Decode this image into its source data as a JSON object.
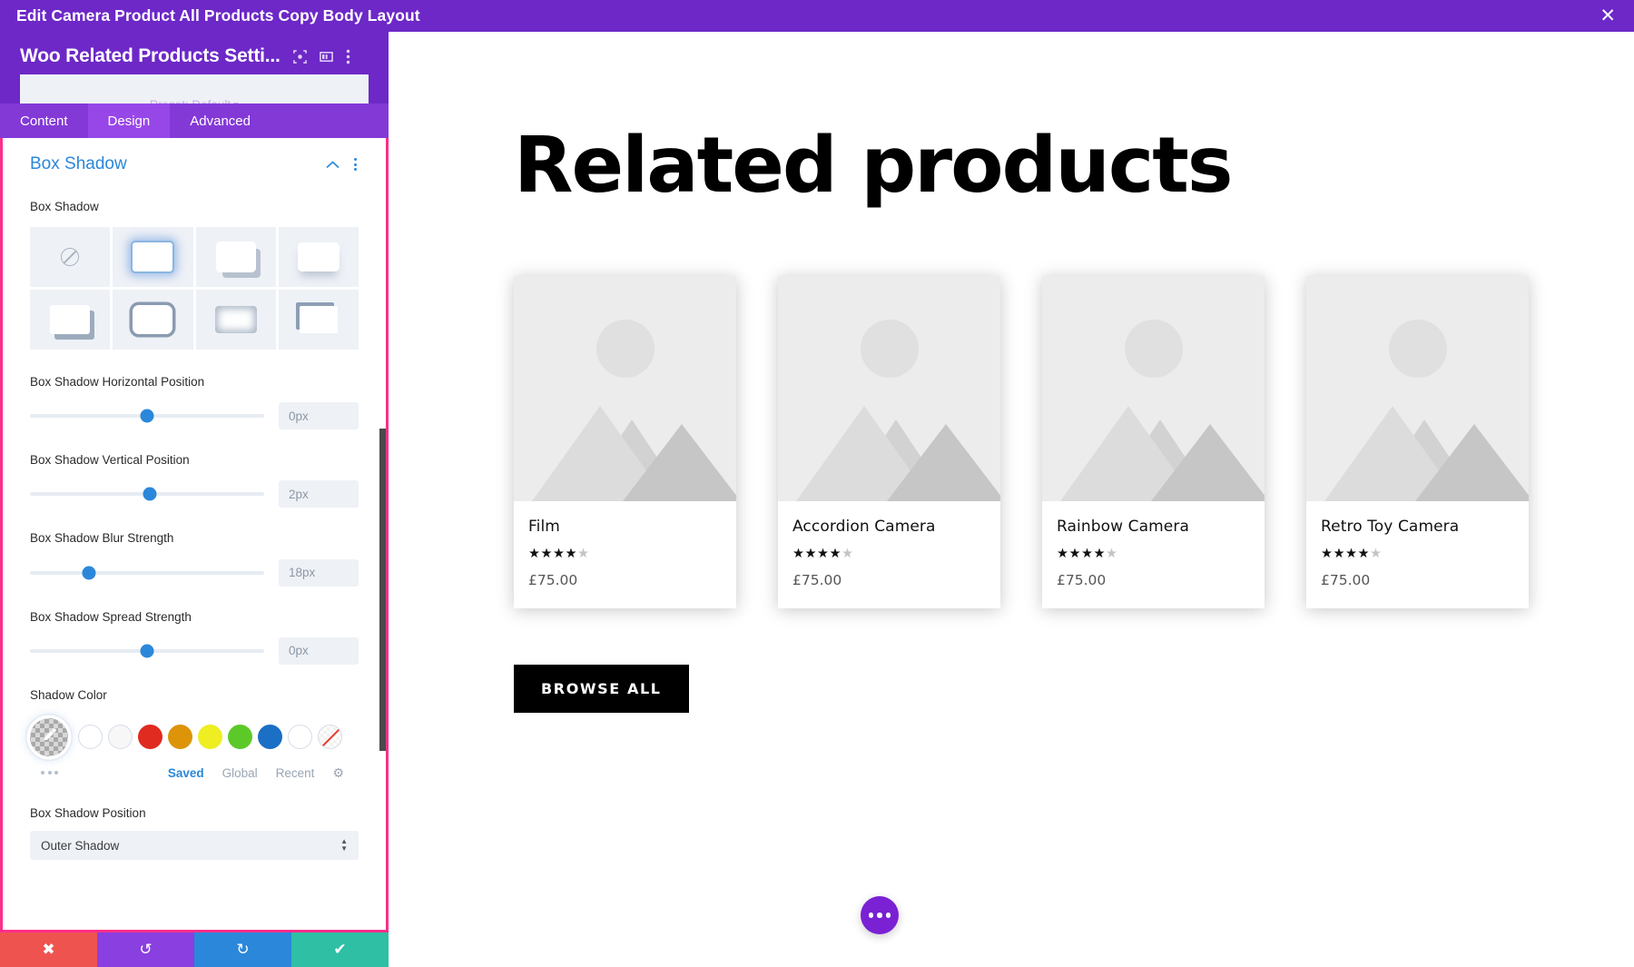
{
  "topbar": {
    "title": "Edit Camera Product All Products Copy Body Layout",
    "close_icon": "close-icon",
    "close_glyph": "✕"
  },
  "panel": {
    "title": "Woo Related Products Setti...",
    "preset_label": "Preset: Default",
    "header_icons": [
      "focus-icon",
      "layout-columns-icon",
      "kebab-menu-icon"
    ],
    "tabs": [
      {
        "label": "Content",
        "selected": false
      },
      {
        "label": "Design",
        "selected": true
      },
      {
        "label": "Advanced",
        "selected": false
      }
    ]
  },
  "section": {
    "title": "Box Shadow",
    "collapse_icon": "chevron-up-icon",
    "menu_icon": "kebab-menu-icon"
  },
  "box_shadow": {
    "field_label": "Box Shadow",
    "presets": [
      {
        "name": "none",
        "selected": false
      },
      {
        "name": "glow",
        "selected": true
      },
      {
        "name": "bottom-right-hard",
        "selected": false
      },
      {
        "name": "bottom-soft",
        "selected": false
      },
      {
        "name": "offset-bottom-right",
        "selected": false
      },
      {
        "name": "outline-ring",
        "selected": false
      },
      {
        "name": "inner-blur",
        "selected": false
      },
      {
        "name": "top-left-edge",
        "selected": false
      }
    ]
  },
  "sliders": [
    {
      "label": "Box Shadow Horizontal Position",
      "value": "0px",
      "pos_pct": 50
    },
    {
      "label": "Box Shadow Vertical Position",
      "value": "2px",
      "pos_pct": 51
    },
    {
      "label": "Box Shadow Blur Strength",
      "value": "18px",
      "pos_pct": 25
    },
    {
      "label": "Box Shadow Spread Strength",
      "value": "0px",
      "pos_pct": 50
    }
  ],
  "shadow_color": {
    "label": "Shadow Color",
    "active_swatch": "eyedropper-transparent",
    "swatches": [
      {
        "name": "swatch-white-1",
        "hex": "#ffffff",
        "ring": true
      },
      {
        "name": "swatch-white-2",
        "hex": "#f7f7f7",
        "ring": true
      },
      {
        "name": "swatch-red",
        "hex": "#e02b20"
      },
      {
        "name": "swatch-orange",
        "hex": "#dd9409"
      },
      {
        "name": "swatch-yellow",
        "hex": "#eeee22"
      },
      {
        "name": "swatch-green",
        "hex": "#5cc928"
      },
      {
        "name": "swatch-blue",
        "hex": "#1b6fc4"
      },
      {
        "name": "swatch-white-3",
        "hex": "#ffffff",
        "ring": true
      },
      {
        "name": "swatch-none",
        "hex": "none"
      }
    ],
    "tabs": [
      {
        "label": "Saved",
        "active": true
      },
      {
        "label": "Global",
        "active": false
      },
      {
        "label": "Recent",
        "active": false
      }
    ],
    "gear_icon": "gear-icon",
    "gear_glyph": "⚙",
    "more_icon": "more-dots-icon"
  },
  "position": {
    "label": "Box Shadow Position",
    "value": "Outer Shadow"
  },
  "actionbar": [
    {
      "name": "cancel-button",
      "glyph": "✖",
      "color": "#ef5350"
    },
    {
      "name": "undo-button",
      "glyph": "↺",
      "color": "#8a3fe0"
    },
    {
      "name": "redo-button",
      "glyph": "↻",
      "color": "#2b87da"
    },
    {
      "name": "save-button",
      "glyph": "✔",
      "color": "#2ebfa5"
    }
  ],
  "preview": {
    "heading": "Related products",
    "browse_label": "BROWSE ALL",
    "fab_icon": "more-dots-icon",
    "products": [
      {
        "name": "Film",
        "price": "£75.00",
        "rating": 4,
        "max_rating": 5
      },
      {
        "name": "Accordion Camera",
        "price": "£75.00",
        "rating": 4,
        "max_rating": 5
      },
      {
        "name": "Rainbow Camera",
        "price": "£75.00",
        "rating": 4,
        "max_rating": 5
      },
      {
        "name": "Retro Toy Camera",
        "price": "£75.00",
        "rating": 4,
        "max_rating": 5
      }
    ]
  }
}
